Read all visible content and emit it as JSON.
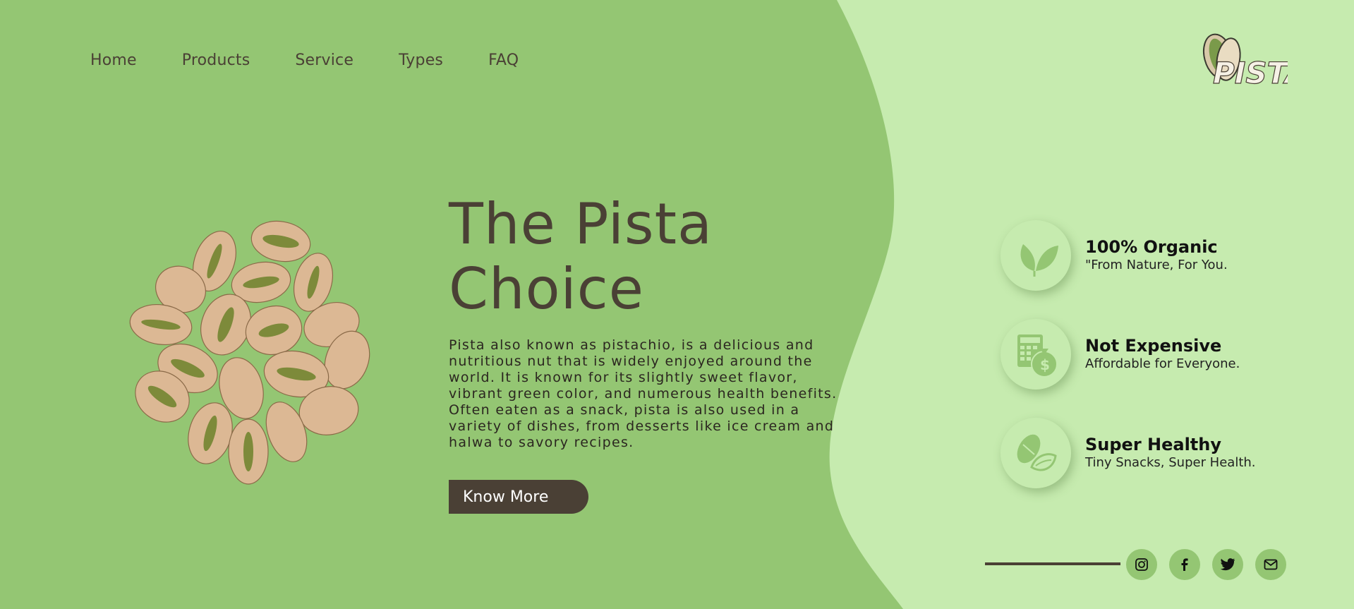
{
  "nav": {
    "items": [
      {
        "label": "Home"
      },
      {
        "label": "Products"
      },
      {
        "label": "Service"
      },
      {
        "label": "Types"
      },
      {
        "label": "FAQ"
      }
    ]
  },
  "logo": {
    "text": "PISTA"
  },
  "hero": {
    "title_line1": "The Pista",
    "title_line2": "Choice",
    "description": "Pista also known as pistachio, is a delicious and nutritious nut that is widely enjoyed around the world. It is known for its slightly sweet flavor, vibrant green color, and numerous health benefits. Often eaten as a snack, pista is also used in a variety of dishes, from desserts like ice cream and halwa to savory recipes.",
    "button_label": "Know More"
  },
  "features": [
    {
      "title": "100% Organic",
      "subtitle": "\"From Nature, For You.",
      "icon": "leaf-icon"
    },
    {
      "title": "Not Expensive",
      "subtitle": "Affordable for Everyone.",
      "icon": "money-bag-icon"
    },
    {
      "title": "Super Healthy",
      "subtitle": "Tiny Snacks, Super Health.",
      "icon": "pistachio-icon"
    }
  ],
  "social": [
    {
      "icon": "instagram-icon"
    },
    {
      "icon": "facebook-icon"
    },
    {
      "icon": "twitter-icon"
    },
    {
      "icon": "mail-icon"
    }
  ],
  "colors": {
    "primary_bg": "#94c673",
    "light_bg": "#c6ebaf",
    "dark_text": "#4a4035",
    "button": "#4a4035"
  }
}
